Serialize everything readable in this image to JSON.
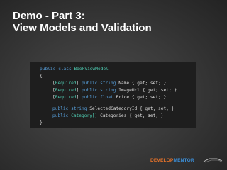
{
  "slide": {
    "title_line1": "Demo - Part 3:",
    "title_line2": "View Models and Validation"
  },
  "code": {
    "class_decl": {
      "modifiers": "public class",
      "name": "BookViewModel"
    },
    "open_brace": "{",
    "close_brace": "}",
    "properties": [
      {
        "attr_open": "[",
        "attr": "Required",
        "attr_close": "]",
        "modifiers": "public",
        "type": "string",
        "rest": "Name { get; set; }"
      },
      {
        "attr_open": "[",
        "attr": "Required",
        "attr_close": "]",
        "modifiers": "public",
        "type": "string",
        "rest": "ImageUrl { get; set; }"
      },
      {
        "attr_open": "[",
        "attr": "Required",
        "attr_close": "]",
        "modifiers": "public",
        "type": "float",
        "rest": "Price { get; set; }"
      },
      {
        "attr_open": "",
        "attr": "",
        "attr_close": "",
        "modifiers": "public",
        "type": "string",
        "rest": "SelectedCategoryId { get; set; }"
      },
      {
        "attr_open": "",
        "attr": "",
        "attr_close": "",
        "modifiers": "public",
        "type": "Category[]",
        "rest": "Categories { get; set; }"
      }
    ]
  },
  "footer": {
    "logo_part1": "DEVELOP",
    "logo_part2": "MENTOR"
  },
  "colors": {
    "keyword": "#569cd6",
    "attribute": "#4ec9b0",
    "code_background": "#1e1e1e",
    "logo_orange": "#e8732a",
    "logo_blue": "#3b8fd9"
  }
}
